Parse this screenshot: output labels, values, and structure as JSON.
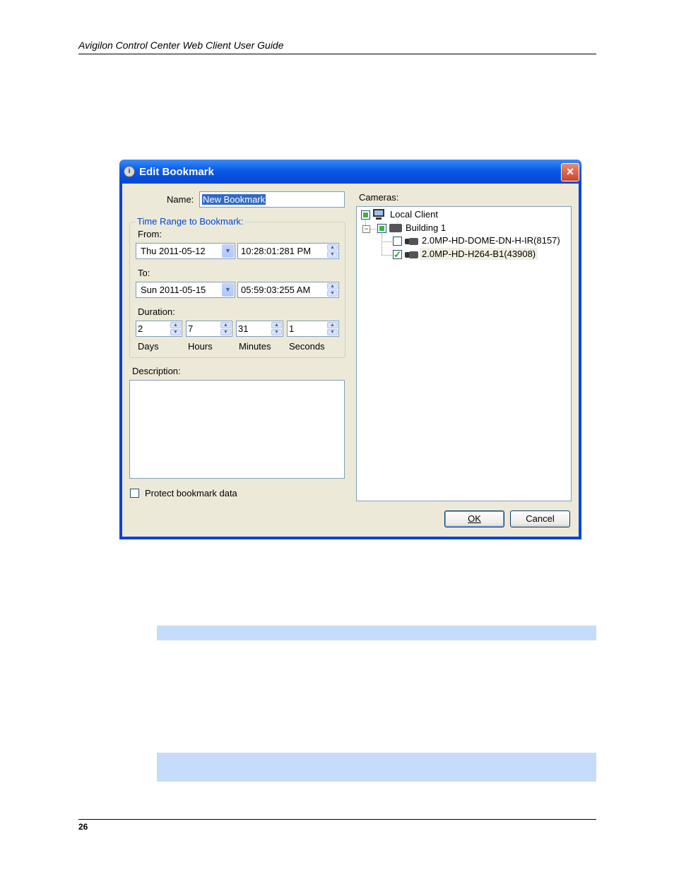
{
  "page": {
    "header_title": "Avigilon Control Center Web Client User Guide",
    "page_number": "26"
  },
  "dialog": {
    "title": "Edit Bookmark",
    "close_glyph": "×",
    "name_label": "Name:",
    "name_value": "New Bookmark",
    "time_range_legend": "Time Range to Bookmark:",
    "from_label": "From:",
    "from_date": "Thu  2011-05-12",
    "from_time": "10:28:01:281  PM",
    "to_label": "To:",
    "to_date": "Sun  2011-05-15",
    "to_time": "05:59:03:255  AM",
    "duration_label": "Duration:",
    "duration": {
      "days": "2",
      "hours": "7",
      "minutes": "31",
      "seconds": "1",
      "days_label": "Days",
      "hours_label": "Hours",
      "minutes_label": "Minutes",
      "seconds_label": "Seconds"
    },
    "description_label": "Description:",
    "description_value": "",
    "protect_label": "Protect bookmark data",
    "cameras_label": "Cameras:",
    "tree": {
      "root": "Local Client",
      "site": "Building 1",
      "cameras": [
        "2.0MP-HD-DOME-DN-H-IR(8157)",
        "2.0MP-HD-H264-B1(43908)"
      ]
    },
    "ok_label": "OK",
    "cancel_label": "Cancel"
  },
  "icons": [
    "info-icon",
    "close-icon",
    "chevron-down-icon",
    "spin-up-icon",
    "spin-down-icon",
    "monitor-icon",
    "server-icon",
    "camera-icon",
    "checkmark-icon",
    "collapse-icon"
  ],
  "colors": {
    "title_bar": "#0a5ae6",
    "dialog_face": "#ece9d8",
    "group_legend": "#0046d5",
    "selection": "#316ac5",
    "info_bar": "#c6dcfb"
  }
}
